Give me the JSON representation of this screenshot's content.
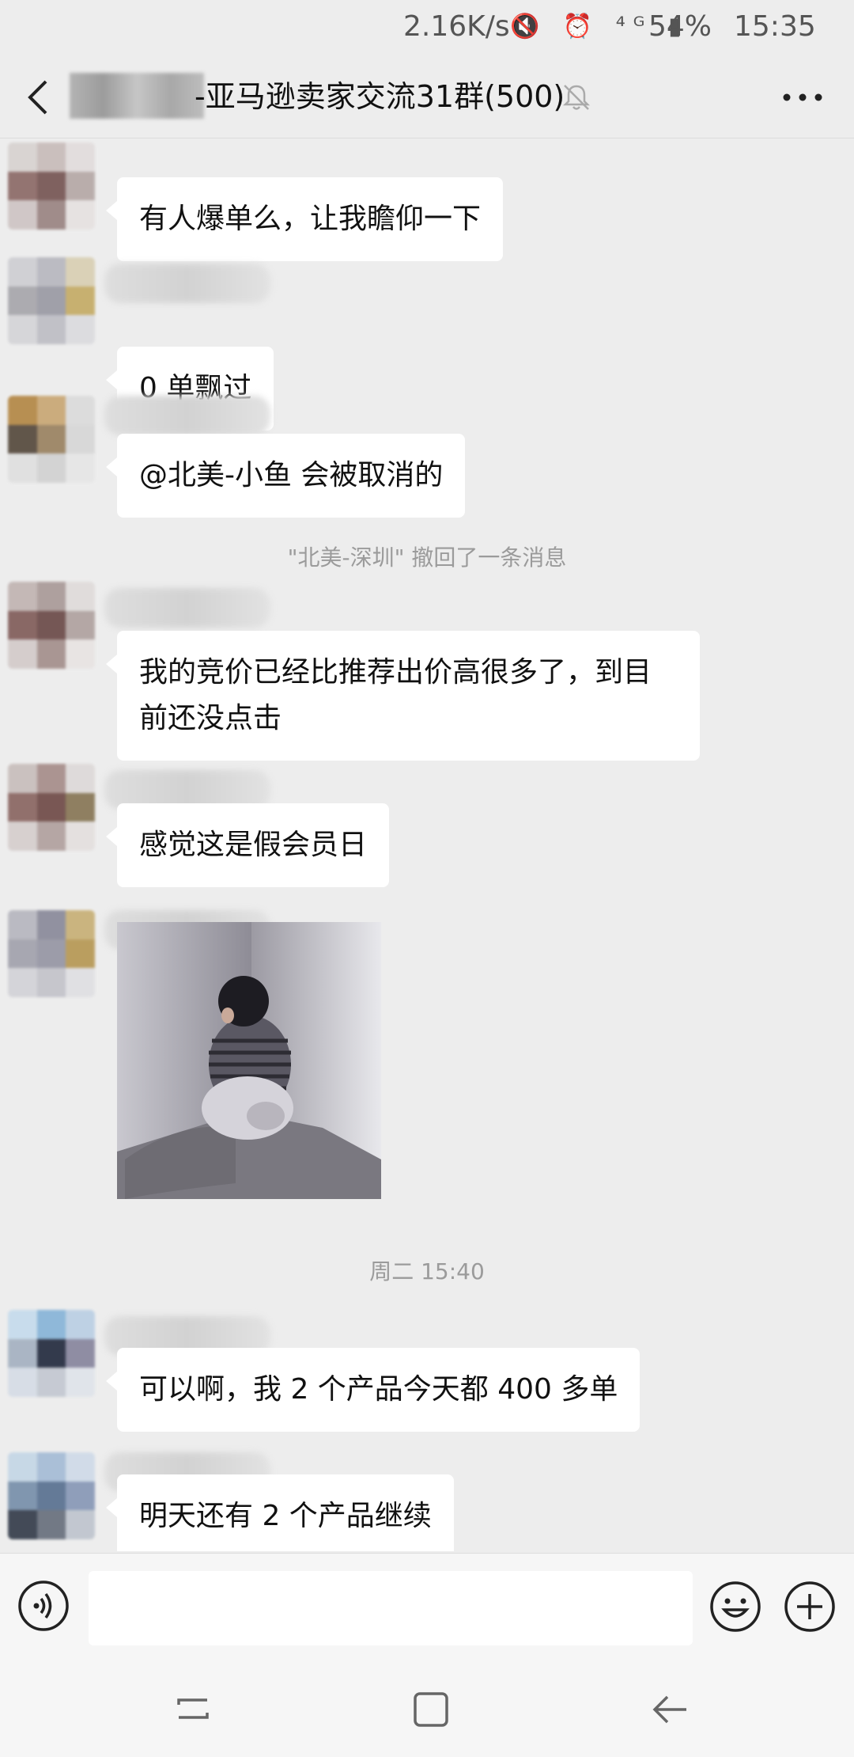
{
  "status_bar": {
    "speed": "2.16K/s",
    "icons": "🔇 ⏰ ⁴ᴳ ▮",
    "battery": "54%",
    "time": "15:35"
  },
  "header": {
    "title": "-亚马逊卖家交流31群(500)",
    "icons": [
      "back-icon",
      "mute-bell-icon",
      "more-icon"
    ]
  },
  "messages": [
    {
      "type": "text",
      "text": "有人爆单么，让我瞻仰一下"
    },
    {
      "type": "text",
      "text": "0 单飘过"
    },
    {
      "type": "text",
      "text": "@北美-小鱼 会被取消的"
    },
    {
      "type": "system",
      "text": "\"北美-深圳\" 撤回了一条消息"
    },
    {
      "type": "text",
      "line1": "我的竞价已经比推荐出价高很多了，到目",
      "line2": "前还没点击"
    },
    {
      "type": "text",
      "text": "感觉这是假会员日"
    },
    {
      "type": "image",
      "alt": ""
    },
    {
      "type": "time",
      "text": "周二 15:40"
    },
    {
      "type": "text",
      "text": "可以啊，我 2 个产品今天都 400 多单"
    },
    {
      "type": "text",
      "text": "明天还有 2 个产品继续"
    }
  ],
  "input_bar": {
    "value": "",
    "icons": [
      "voice-icon",
      "emoji-icon",
      "plus-icon"
    ]
  },
  "nav_bar": {
    "icons": [
      "recent-apps-icon",
      "home-icon",
      "back-nav-icon"
    ]
  },
  "colors": {
    "background": "#ededed",
    "bubble": "#ffffff",
    "system_text": "#9b9b9b"
  }
}
